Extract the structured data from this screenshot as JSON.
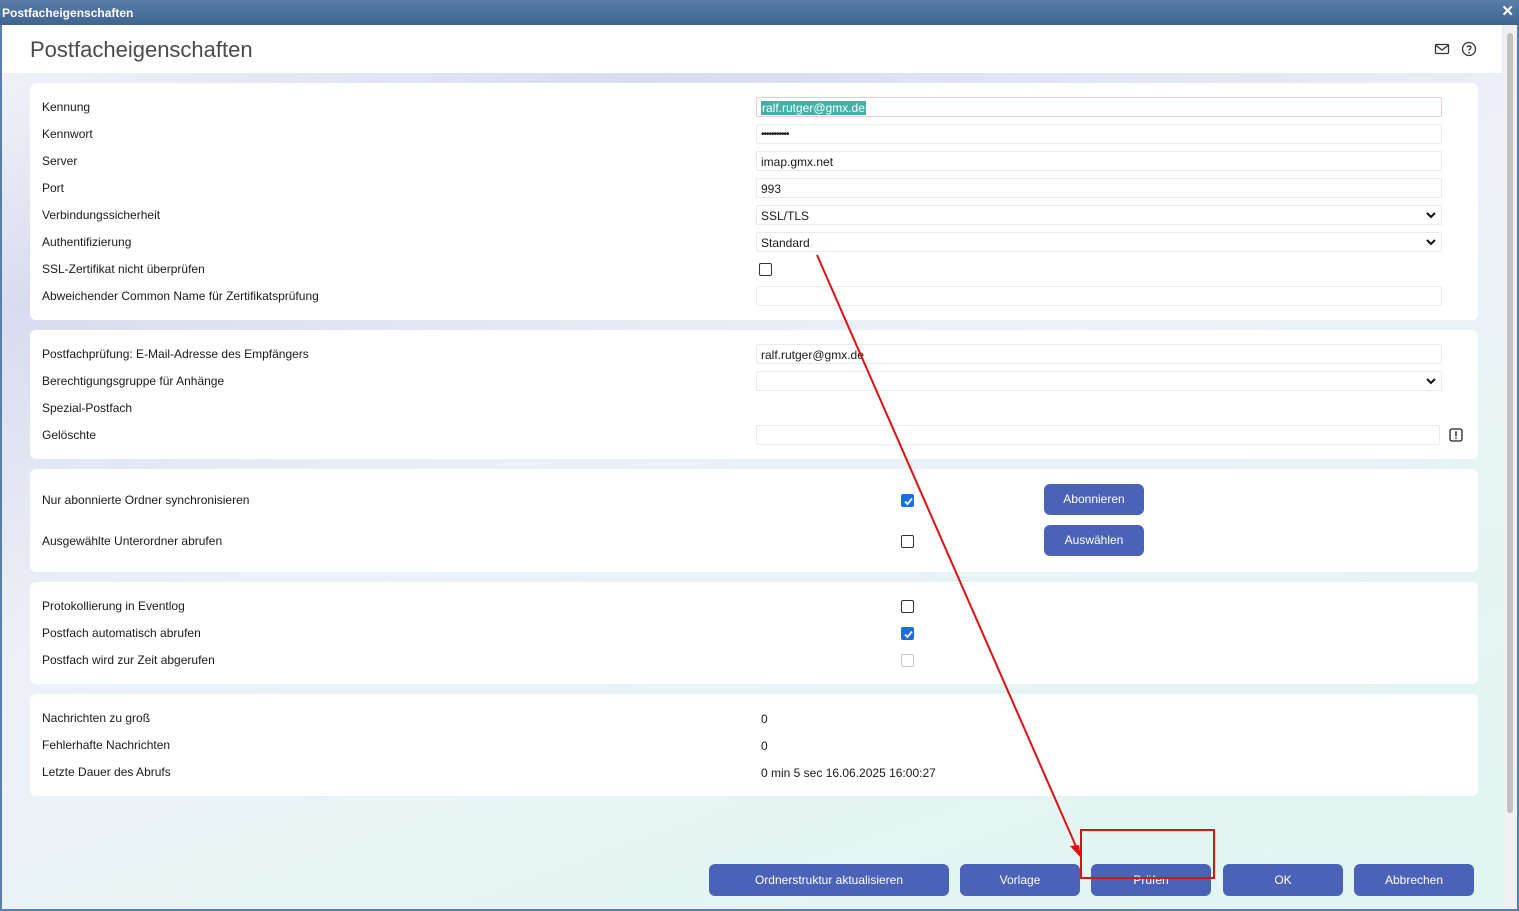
{
  "window": {
    "title": "Postfacheigenschaften",
    "close_glyph": "✕"
  },
  "header": {
    "title": "Postfacheigenschaften",
    "icons": [
      "mail-icon",
      "help-icon"
    ]
  },
  "section_account": {
    "rows": [
      {
        "label": "Kennung",
        "value": "ralf.rutger@gmx.de",
        "type": "text-selected"
      },
      {
        "label": "Kennwort",
        "value": "•••••••••••",
        "type": "password"
      },
      {
        "label": "Server",
        "value": "imap.gmx.net",
        "type": "text"
      },
      {
        "label": "Port",
        "value": "993",
        "type": "text"
      },
      {
        "label": "Verbindungssicherheit",
        "value": "SSL/TLS",
        "type": "select"
      },
      {
        "label": "Authentifizierung",
        "value": "Standard",
        "type": "select"
      },
      {
        "label": "SSL-Zertifikat nicht überprüfen",
        "value": false,
        "type": "checkbox"
      },
      {
        "label": "Abweichender Common Name für Zertifikatsprüfung",
        "value": "",
        "type": "text"
      }
    ]
  },
  "section_check": {
    "rows": [
      {
        "label": "Postfachprüfung: E-Mail-Adresse des Empfängers",
        "value": "ralf.rutger@gmx.de",
        "type": "text"
      },
      {
        "label": "Berechtigungsgruppe für Anhänge",
        "value": "",
        "type": "select"
      },
      {
        "label": "Spezial-Postfach",
        "type": "heading"
      },
      {
        "label": "Gelöschte",
        "value": "",
        "type": "text",
        "icon": "warning-icon"
      }
    ]
  },
  "section_folders": {
    "rows": [
      {
        "label": "Nur abonnierte Ordner synchronisieren",
        "checked": true,
        "button": "Abonnieren"
      },
      {
        "label": "Ausgewählte Unterordner abrufen",
        "checked": false,
        "button": "Auswählen"
      }
    ]
  },
  "section_logging": {
    "rows": [
      {
        "label": "Protokollierung in Eventlog",
        "checked": false
      },
      {
        "label": "Postfach automatisch abrufen",
        "checked": true
      },
      {
        "label": "Postfach wird zur Zeit abgerufen",
        "checked": false,
        "disabled": true
      }
    ]
  },
  "section_stats": {
    "rows": [
      {
        "label": "Nachrichten zu groß",
        "value": "0"
      },
      {
        "label": "Fehlerhafte Nachrichten",
        "value": "0"
      },
      {
        "label": "Letzte Dauer des Abrufs",
        "value": "0 min 5 sec 16.06.2025 16:00:27"
      }
    ]
  },
  "footer": {
    "buttons": {
      "refresh": "Ordnerstruktur aktualisieren",
      "template": "Vorlage",
      "check": "Prüfen",
      "ok": "OK",
      "cancel": "Abbrechen"
    }
  },
  "annotation": {
    "color": "#e01010"
  }
}
